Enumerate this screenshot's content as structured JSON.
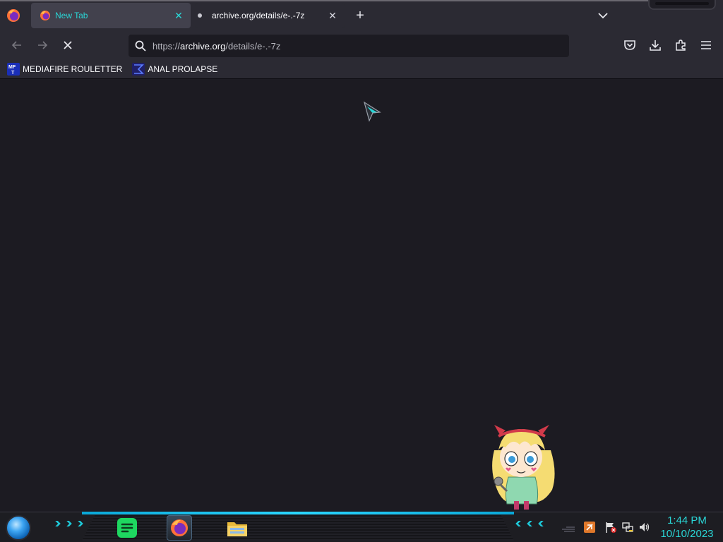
{
  "browser": {
    "tabs": [
      {
        "title": "New Tab",
        "active": false,
        "close_glyph": "✕",
        "favicon": "firefox-icon"
      },
      {
        "title": "archive.org/details/e-.-7z",
        "active": true,
        "close_glyph": "✕",
        "favicon": "loading-dot"
      }
    ],
    "new_tab_glyph": "+",
    "address": {
      "scheme": "https://",
      "domain": "archive.org",
      "path": "/details/e-.-7z"
    },
    "bookmarks": [
      {
        "label": "MEDIAFIRE ROULETTER",
        "icon": "mediafire-icon"
      },
      {
        "label": "ANAL PROLAPSE",
        "icon": "sigma-icon"
      }
    ]
  },
  "taskbar": {
    "apps": [
      "spotify-icon",
      "firefox-icon",
      "file-explorer-icon"
    ],
    "clock": {
      "time": "1:44 PM",
      "date": "10/10/2023"
    }
  },
  "colors": {
    "accent": "#2ad6d6",
    "chrome": "#2b2a33",
    "page": "#1c1b22"
  }
}
